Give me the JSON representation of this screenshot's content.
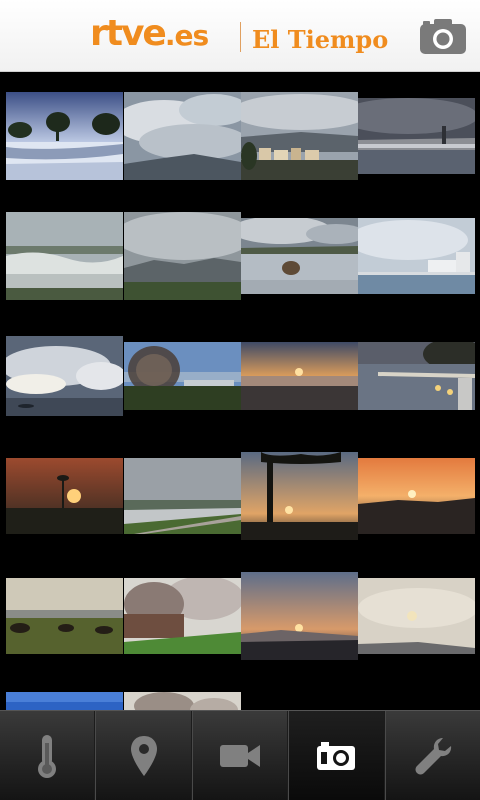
{
  "header": {
    "logo_main": "rtve",
    "logo_suffix": ".es",
    "section_title": "El Tiempo",
    "camera_icon": "camera-icon"
  },
  "gallery": {
    "photos": [
      {
        "name": "snowy-field-trees"
      },
      {
        "name": "cloudy-mountains"
      },
      {
        "name": "town-cloudy-sky"
      },
      {
        "name": "coastal-city-dusk"
      },
      {
        "name": "misty-plain"
      },
      {
        "name": "grey-clouds-hills"
      },
      {
        "name": "reflection-lake-rock"
      },
      {
        "name": "seafront-buildings"
      },
      {
        "name": "clouds-over-sea"
      },
      {
        "name": "bare-tree"
      },
      {
        "name": "beach-sunset"
      },
      {
        "name": "promenade-lights"
      },
      {
        "name": "red-sunset-palm"
      },
      {
        "name": "river-landscape"
      },
      {
        "name": "palm-sunset"
      },
      {
        "name": "orange-sunset"
      },
      {
        "name": "horses-field"
      },
      {
        "name": "blossom-tree"
      },
      {
        "name": "sunset-bay"
      },
      {
        "name": "hazy-sun"
      },
      {
        "name": "blue-sky-partial"
      },
      {
        "name": "blossom-partial"
      }
    ]
  },
  "tabbar": {
    "tabs": [
      {
        "id": "temperature",
        "icon": "thermometer-icon",
        "active": false
      },
      {
        "id": "map",
        "icon": "location-pin-icon",
        "active": false
      },
      {
        "id": "video",
        "icon": "video-camera-icon",
        "active": false
      },
      {
        "id": "photos",
        "icon": "camera-icon",
        "active": true
      },
      {
        "id": "settings",
        "icon": "wrench-icon",
        "active": false
      }
    ]
  },
  "colors": {
    "brand_orange": "#f08c1e",
    "background": "#000000",
    "tabbar_top": "#3a3a3a",
    "tabbar_bottom": "#141414"
  }
}
